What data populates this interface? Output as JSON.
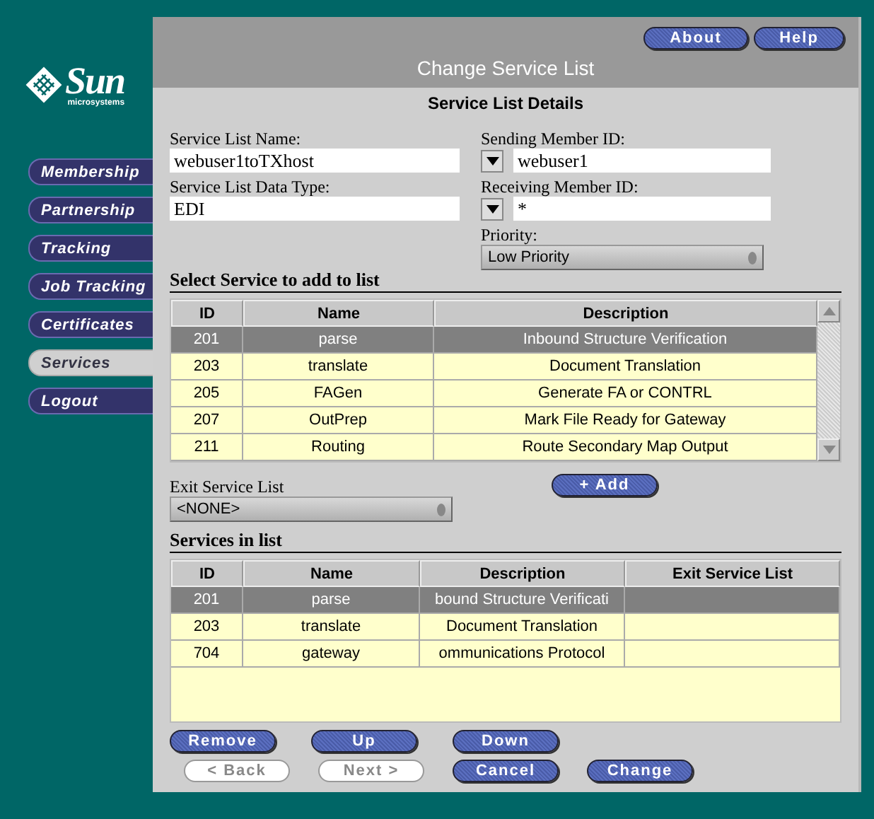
{
  "logo": {
    "wordmark": "Sun",
    "tagline": "microsystems"
  },
  "nav": [
    {
      "label": "Membership",
      "selected": false
    },
    {
      "label": "Partnership",
      "selected": false
    },
    {
      "label": "Tracking",
      "selected": false
    },
    {
      "label": "Job Tracking",
      "selected": false
    },
    {
      "label": "Certificates",
      "selected": false
    },
    {
      "label": "Services",
      "selected": true
    },
    {
      "label": "Logout",
      "selected": false
    }
  ],
  "header": {
    "title": "Change Service List",
    "buttons": [
      "About",
      "Help"
    ]
  },
  "section_title": "Service List Details",
  "form": {
    "service_list_name": {
      "label": "Service List Name:",
      "value": "webuser1toTXhost"
    },
    "service_list_data_type": {
      "label": "Service List Data Type:",
      "value": "EDI"
    },
    "sending_member_id": {
      "label": "Sending Member ID:",
      "value": "webuser1"
    },
    "receiving_member_id": {
      "label": "Receiving Member ID:",
      "value": "*"
    },
    "priority": {
      "label": "Priority:",
      "value": "Low Priority"
    }
  },
  "available": {
    "heading": "Select Service to add to list",
    "columns": [
      "ID",
      "Name",
      "Description"
    ],
    "rows": [
      {
        "cells": [
          "201",
          "parse",
          "Inbound Structure Verification"
        ],
        "selected": true
      },
      {
        "cells": [
          "203",
          "translate",
          "Document Translation"
        ],
        "selected": false
      },
      {
        "cells": [
          "205",
          "FAGen",
          "Generate FA or CONTRL"
        ],
        "selected": false
      },
      {
        "cells": [
          "207",
          "OutPrep",
          "Mark File Ready for Gateway"
        ],
        "selected": false
      },
      {
        "cells": [
          "211",
          "Routing",
          "Route Secondary Map Output"
        ],
        "selected": false
      }
    ]
  },
  "exit_service_list": {
    "label": "Exit Service List",
    "value": "<NONE>"
  },
  "add_button": "+ Add",
  "in_list": {
    "heading": "Services in list",
    "columns": [
      "ID",
      "Name",
      "Description",
      "Exit Service List"
    ],
    "rows": [
      {
        "cells": [
          "201",
          "parse",
          "bound Structure Verificati",
          ""
        ],
        "selected": true
      },
      {
        "cells": [
          "203",
          "translate",
          "Document Translation",
          ""
        ],
        "selected": false
      },
      {
        "cells": [
          "704",
          "gateway",
          "ommunications Protocol",
          ""
        ],
        "selected": false
      }
    ]
  },
  "list_buttons": [
    {
      "label": "Remove",
      "disabled": false
    },
    {
      "label": "Up",
      "disabled": false
    },
    {
      "label": "Down",
      "disabled": false
    }
  ],
  "nav_buttons": [
    {
      "label": "< Back",
      "disabled": true
    },
    {
      "label": "Next >",
      "disabled": true
    },
    {
      "label": "Cancel",
      "disabled": false
    },
    {
      "label": "Change",
      "disabled": false
    }
  ]
}
